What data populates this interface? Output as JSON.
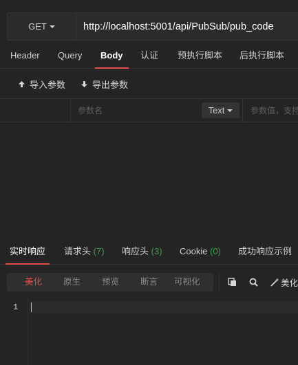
{
  "request": {
    "method": "GET",
    "url": "http://localhost:5001/api/PubSub/pub_code"
  },
  "request_tabs": [
    {
      "label": "Header",
      "active": false
    },
    {
      "label": "Query",
      "active": false
    },
    {
      "label": "Body",
      "active": true
    },
    {
      "label": "认证",
      "active": false
    },
    {
      "label": "预执行脚本",
      "active": false
    },
    {
      "label": "后执行脚本",
      "active": false
    }
  ],
  "tools": {
    "import_label": "导入参数",
    "export_label": "导出参数"
  },
  "params": {
    "name_placeholder": "参数名",
    "type_label": "Text",
    "value_placeholder": "参数值，支持"
  },
  "response_tabs": {
    "realtime": "实时响应",
    "req_headers": "请求头",
    "req_headers_count": "(7)",
    "resp_headers": "响应头",
    "resp_headers_count": "(3)",
    "cookie": "Cookie",
    "cookie_count": "(0)",
    "success_example": "成功响应示例"
  },
  "format_modes": [
    {
      "label": "美化",
      "active": true
    },
    {
      "label": "原生",
      "active": false
    },
    {
      "label": "预览",
      "active": false
    },
    {
      "label": "断言",
      "active": false
    },
    {
      "label": "可视化",
      "active": false
    }
  ],
  "actions": {
    "beautify_label": "美化"
  },
  "editor": {
    "line_number": "1"
  },
  "colors": {
    "accent": "#e2504b",
    "count": "#3fa34d",
    "background": "#242424"
  }
}
